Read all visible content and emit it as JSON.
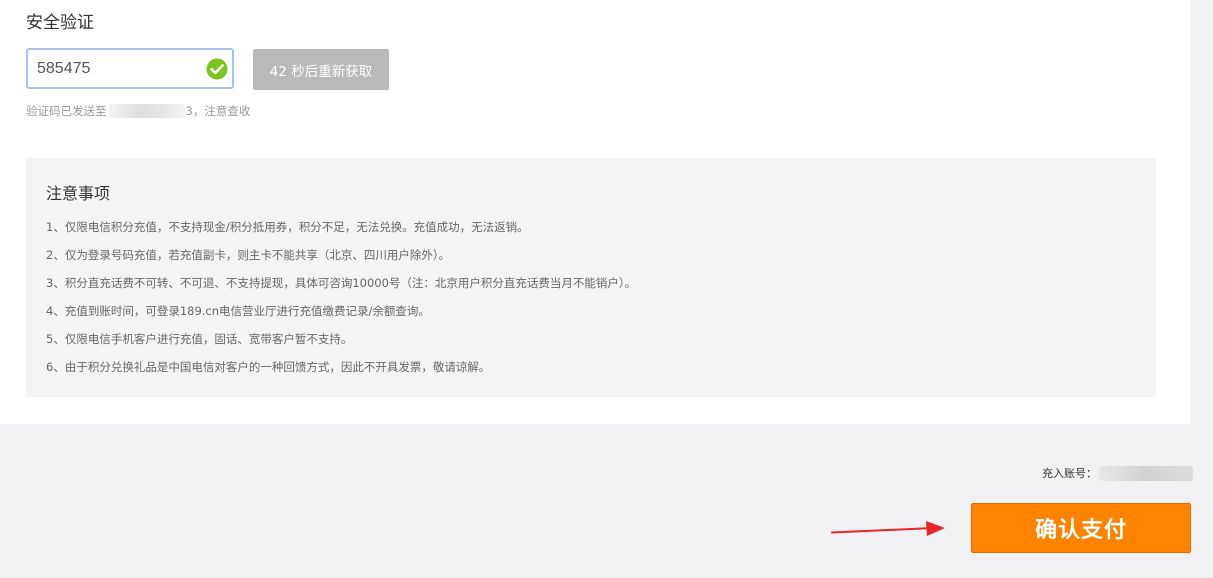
{
  "verification": {
    "title": "安全验证",
    "code_value": "585475",
    "resend_label": "42 秒后重新获取",
    "sent_prefix": "验证码已发送至",
    "sent_suffix": "3，注意查收"
  },
  "notes": {
    "title": "注意事项",
    "items": [
      "1、仅限电信积分充值，不支持现金/积分抵用券，积分不足，无法兑换。充值成功，无法返销。",
      "2、仅为登录号码充值，若充值副卡，则主卡不能共享（北京、四川用户除外）。",
      "3、积分直充话费不可转、不可退、不支持提现，具体可咨询10000号（注：北京用户积分直充话费当月不能销户）。",
      "4、充值到账时间，可登录189.cn电信营业厅进行充值缴费记录/余额查询。",
      "5、仅限电信手机客户进行充值，固话、宽带客户暂不支持。",
      "6、由于积分兑换礼品是中国电信对客户的一种回馈方式，因此不开具发票，敬请谅解。"
    ]
  },
  "account": {
    "label": "充入账号："
  },
  "confirm": {
    "label": "确认支付"
  },
  "colors": {
    "accent": "#ff8200",
    "check": "#7cc51f",
    "arrow": "#e8262a"
  },
  "icons": {
    "check": "check-circle-icon",
    "arrow": "red-arrow-icon"
  }
}
